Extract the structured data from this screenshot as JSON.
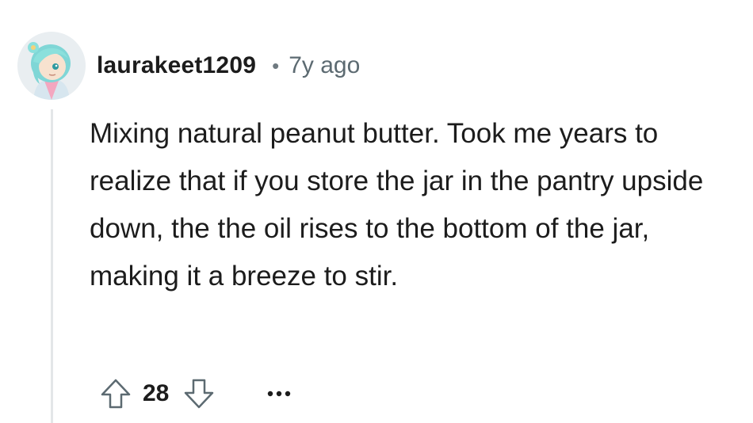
{
  "comment": {
    "author": "laurakeet1209",
    "separator": "•",
    "timestamp": "7y ago",
    "body": "Mixing natural peanut butter. Took me years to realize that if you store the jar in the pantry upside down, the the oil rises to the bottom of the jar, making it a breeze to stir.",
    "score": "28",
    "icons": {
      "avatar": "user-avatar",
      "upvote": "upvote-arrow-icon",
      "downvote": "downvote-arrow-icon",
      "more": "more-options-icon"
    }
  }
}
